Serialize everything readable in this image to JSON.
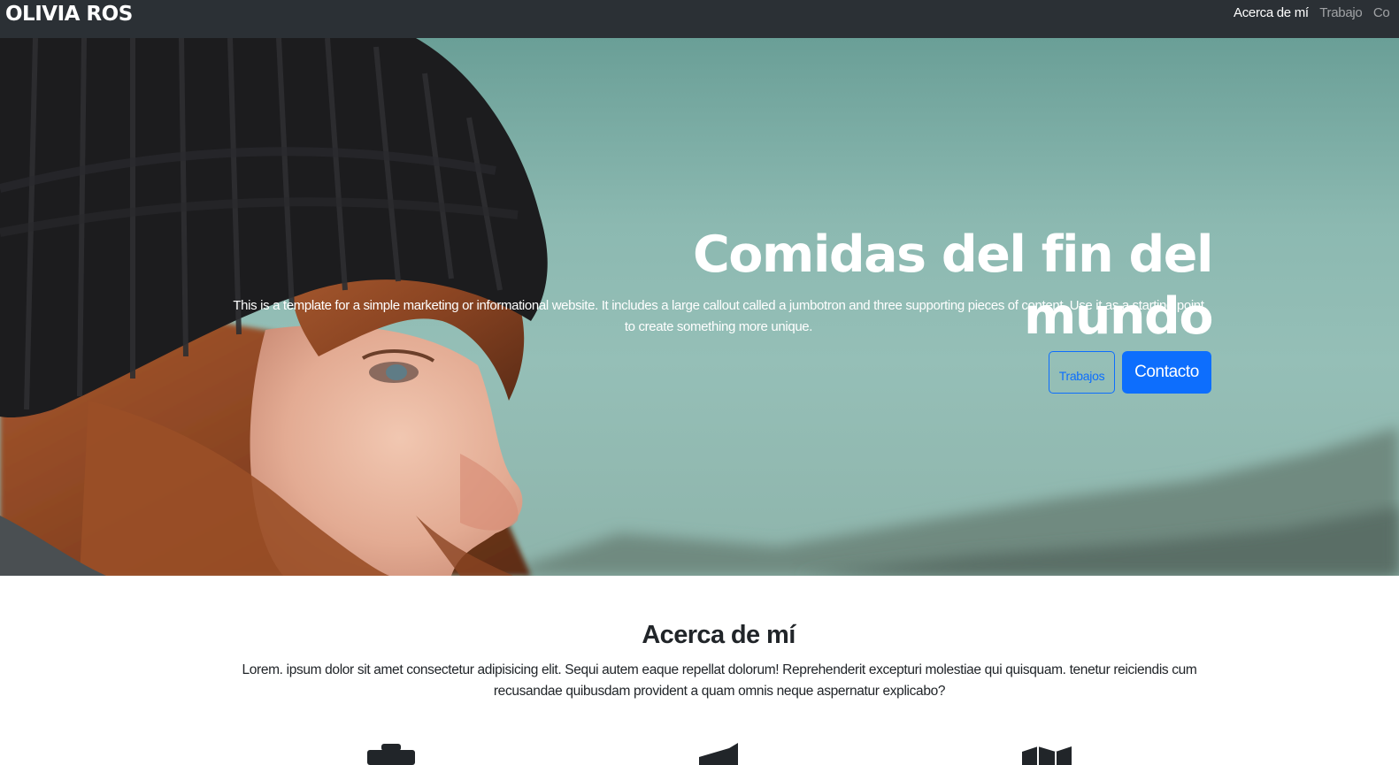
{
  "navbar": {
    "brand": "OLIVIA ROS",
    "links": [
      {
        "label": "Acerca de mí",
        "active": true
      },
      {
        "label": "Trabajo",
        "active": false
      },
      {
        "label": "Co",
        "active": false
      }
    ]
  },
  "hero": {
    "title": "Comidas del fin del mundo",
    "lead": "This is a template for a simple marketing or informational website. It includes a large callout called a jumbotron and three supporting pieces of content. Use it as a starting point to create something more unique.",
    "buttons": {
      "secondary": "Trabajos",
      "primary": "Contacto"
    }
  },
  "about": {
    "title": "Acerca de mí",
    "text": "Lorem. ipsum dolor sit amet consectetur adipisicing elit. Sequi autem eaque repellat dolorum! Reprehenderit excepturi molestiae qui quisquam. tenetur reiciendis cum recusandae quibusdam provident a quam omnis neque aspernatur explicabo?"
  },
  "features": {
    "icons": [
      "briefcase-icon",
      "megaphone-icon",
      "map-icon"
    ]
  },
  "colors": {
    "navbar_bg": "#2b3035",
    "primary": "#0d6efd",
    "hero_sky": "#8cb9b1"
  }
}
